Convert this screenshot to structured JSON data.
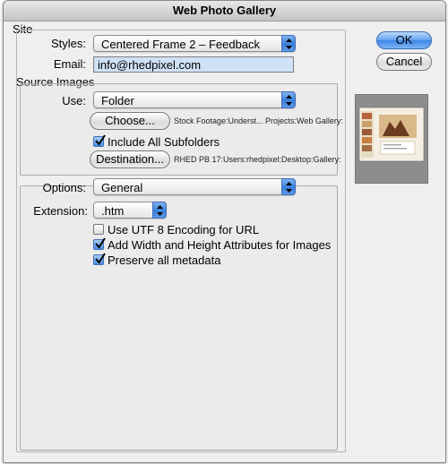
{
  "window": {
    "title": "Web Photo Gallery"
  },
  "buttons": {
    "ok": "OK",
    "cancel": "Cancel"
  },
  "site": {
    "group_title": "Site",
    "styles_label": "Styles:",
    "styles_value": "Centered Frame 2 – Feedback",
    "email_label": "Email:",
    "email_value": "info@rhedpixel.com"
  },
  "source": {
    "group_title": "Source Images",
    "use_label": "Use:",
    "use_value": "Folder",
    "choose_button": "Choose...",
    "choose_path": "Stock Footage:Underst... Projects:Web Gallery:",
    "include_subfolders_label": "Include All Subfolders",
    "include_subfolders_checked": true,
    "destination_button": "Destination...",
    "destination_path": "RHED PB 17:Users:rhedpixel:Desktop:Gallery:"
  },
  "options": {
    "label": "Options:",
    "value": "General",
    "extension_label": "Extension:",
    "extension_value": ".htm",
    "checkboxes": [
      {
        "label": "Use UTF 8 Encoding for URL",
        "checked": false
      },
      {
        "label": "Add Width and Height Attributes for Images",
        "checked": true
      },
      {
        "label": "Preserve all metadata",
        "checked": true
      }
    ]
  },
  "colors": {
    "accent": "#3f86e6",
    "field_bg": "#cfe1f6",
    "preview_bg": "#8d8d8d"
  }
}
